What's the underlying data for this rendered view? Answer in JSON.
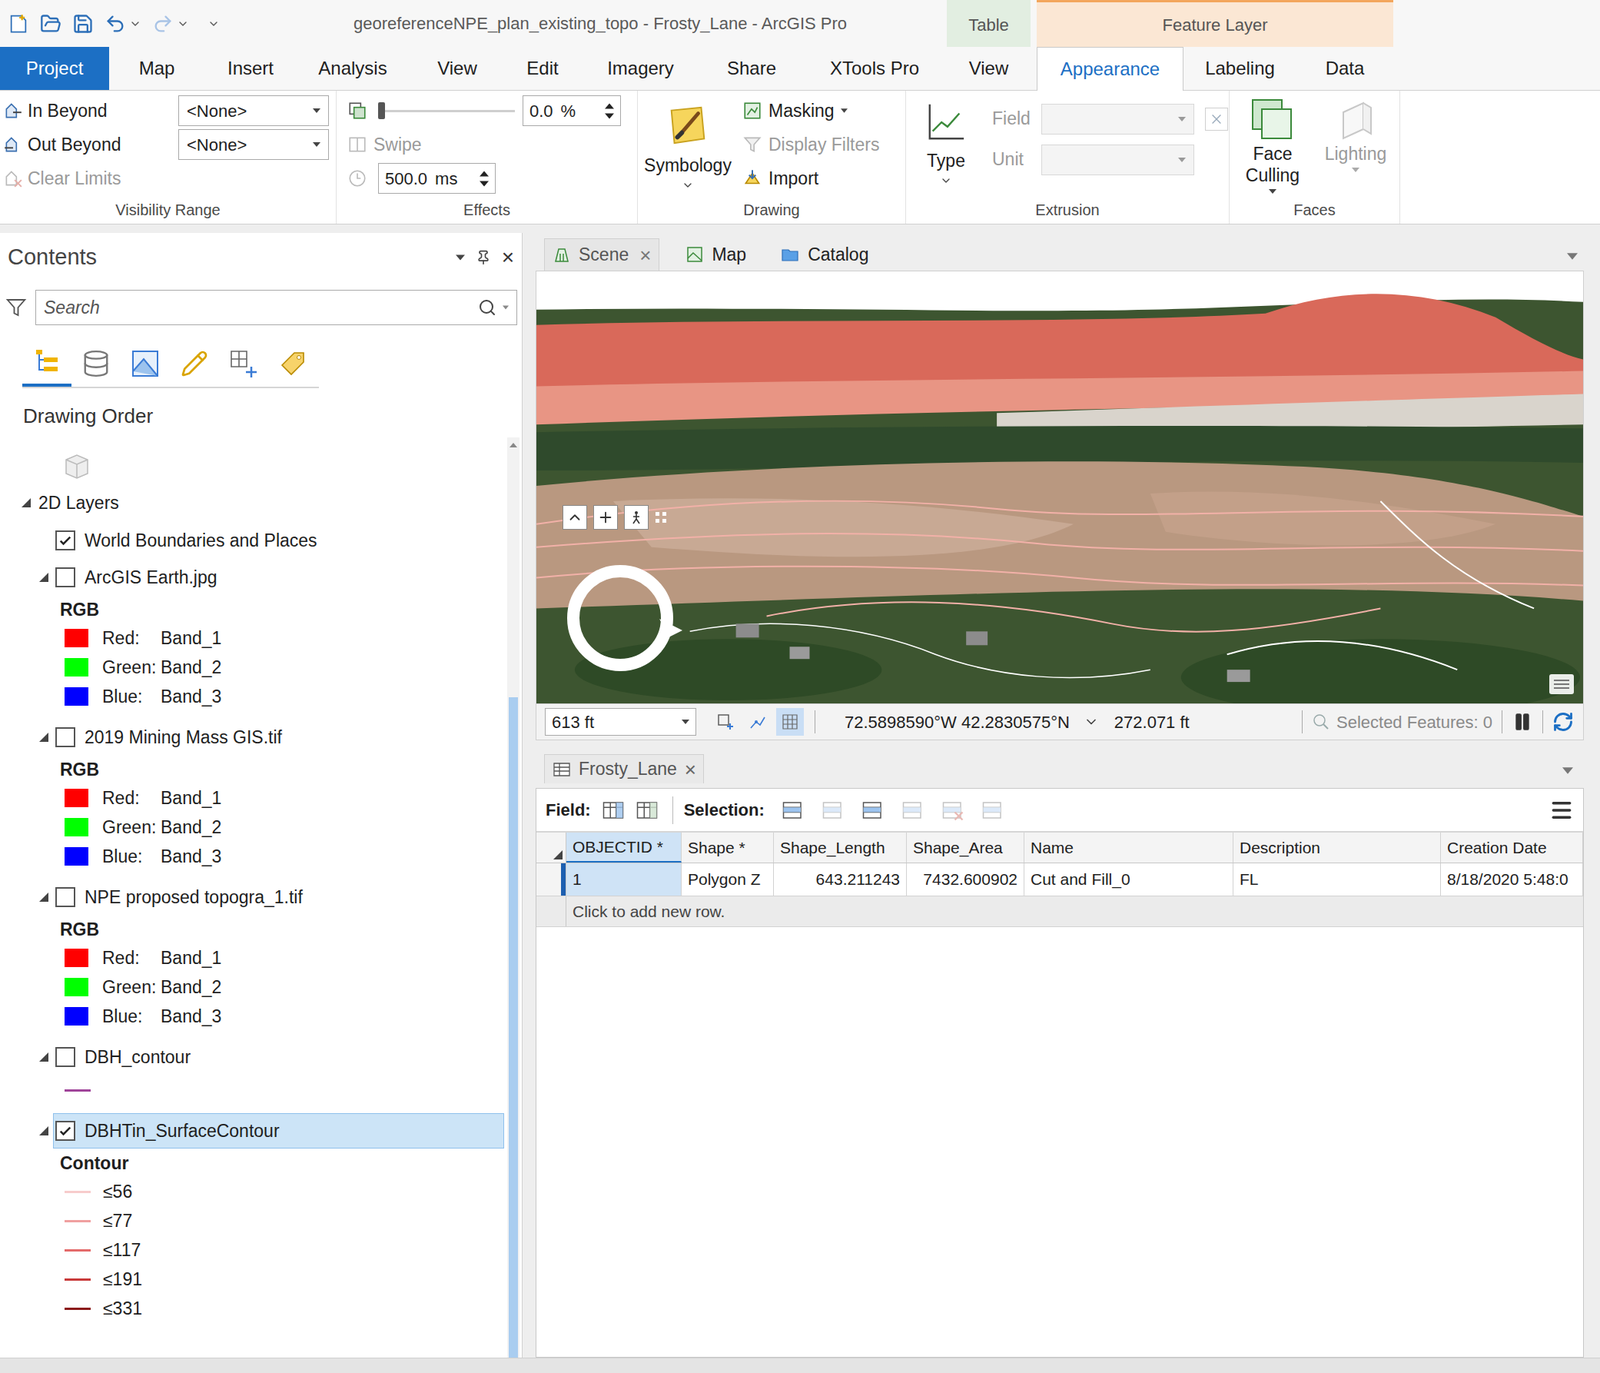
{
  "window": {
    "title": "georeferenceNPE_plan_existing_topo - Frosty_Lane - ArcGIS Pro"
  },
  "contextual_tabs": [
    {
      "label": "Table",
      "color": "#e2eee1",
      "accent": "#e2eee1"
    },
    {
      "label": "Feature Layer",
      "color": "#fbe7d4",
      "accent": "#f3a65c"
    }
  ],
  "ribbon_tabs": [
    {
      "label": "Project",
      "selected": false,
      "context": "none",
      "kind": "backstage"
    },
    {
      "label": "Map",
      "selected": false,
      "context": "none",
      "kind": "core"
    },
    {
      "label": "Insert",
      "selected": false,
      "context": "none",
      "kind": "core"
    },
    {
      "label": "Analysis",
      "selected": false,
      "context": "none",
      "kind": "core"
    },
    {
      "label": "View",
      "selected": false,
      "context": "none",
      "kind": "core"
    },
    {
      "label": "Edit",
      "selected": false,
      "context": "none",
      "kind": "core"
    },
    {
      "label": "Imagery",
      "selected": false,
      "context": "none",
      "kind": "core"
    },
    {
      "label": "Share",
      "selected": false,
      "context": "none",
      "kind": "core"
    },
    {
      "label": "XTools Pro",
      "selected": false,
      "context": "none",
      "kind": "core"
    },
    {
      "label": "View",
      "selected": false,
      "context": "Table",
      "kind": "core"
    },
    {
      "label": "Appearance",
      "selected": true,
      "context": "Feature Layer",
      "kind": "core"
    },
    {
      "label": "Labeling",
      "selected": false,
      "context": "Feature Layer",
      "kind": "core"
    },
    {
      "label": "Data",
      "selected": false,
      "context": "Feature Layer",
      "kind": "core"
    }
  ],
  "ribbon": {
    "visibility_range": {
      "label": "Visibility Range",
      "rows": [
        {
          "label": "In Beyond",
          "value": "<None>",
          "disabled": false
        },
        {
          "label": "Out Beyond",
          "value": "<None>",
          "disabled": false
        }
      ],
      "clear": {
        "label": "Clear Limits",
        "disabled": true
      }
    },
    "effects": {
      "label": "Effects",
      "transparency": {
        "level": 0,
        "value": "0.0",
        "unit": "%"
      },
      "swipe": {
        "label": "Swipe",
        "disabled": true
      },
      "flicker": {
        "value": "500.0",
        "unit": "ms",
        "icon_disabled": true
      }
    },
    "drawing": {
      "label": "Drawing",
      "symbology": {
        "label": "Symbology"
      },
      "items": [
        {
          "label": "Masking",
          "dropdown": true,
          "disabled": false,
          "kind": "masking"
        },
        {
          "label": "Display Filters",
          "dropdown": false,
          "disabled": true,
          "kind": "filters"
        },
        {
          "label": "Import",
          "dropdown": false,
          "disabled": false,
          "kind": "import"
        }
      ]
    },
    "extrusion": {
      "label": "Extrusion",
      "type": {
        "label": "Type"
      },
      "fields": [
        {
          "label": "Field",
          "disabled": true
        },
        {
          "label": "Unit",
          "disabled": true
        }
      ]
    },
    "faces": {
      "label": "Faces",
      "buttons": [
        {
          "lines": [
            "Face",
            "Culling"
          ],
          "disabled": false,
          "kind": "culling"
        },
        {
          "lines": [
            "Lighting"
          ],
          "disabled": true,
          "kind": "lighting"
        }
      ]
    }
  },
  "contents": {
    "title": "Contents",
    "close": "×",
    "search": {
      "placeholder": "Search"
    },
    "toolbar": [
      {
        "kind": "order",
        "selected": true
      },
      {
        "kind": "source",
        "selected": false
      },
      {
        "kind": "selection",
        "selected": false
      },
      {
        "kind": "editing",
        "selected": false
      },
      {
        "kind": "snapping",
        "selected": false
      },
      {
        "kind": "labeling",
        "selected": false
      }
    ],
    "section": "Drawing Order",
    "group": {
      "label": "2D Layers",
      "expanded": true
    },
    "layers": [
      {
        "name": "World Boundaries and Places",
        "checked": true,
        "expanded": false,
        "selected": false,
        "legend": null
      },
      {
        "name": "ArcGIS Earth.jpg",
        "checked": false,
        "expanded": true,
        "selected": false,
        "legend": {
          "kind": "rgb",
          "title": "RGB",
          "bands": [
            {
              "channel": "Red:",
              "band": "Band_1",
              "color": "#ff0000"
            },
            {
              "channel": "Green:",
              "band": "Band_2",
              "color": "#00ff00"
            },
            {
              "channel": "Blue:",
              "band": "Band_3",
              "color": "#0000ff"
            }
          ]
        }
      },
      {
        "name": "2019 Mining Mass GIS.tif",
        "checked": false,
        "expanded": true,
        "selected": false,
        "legend": {
          "kind": "rgb",
          "title": "RGB",
          "bands": [
            {
              "channel": "Red:",
              "band": "Band_1",
              "color": "#ff0000"
            },
            {
              "channel": "Green:",
              "band": "Band_2",
              "color": "#00ff00"
            },
            {
              "channel": "Blue:",
              "band": "Band_3",
              "color": "#0000ff"
            }
          ]
        }
      },
      {
        "name": "NPE proposed topogra_1.tif",
        "checked": false,
        "expanded": true,
        "selected": false,
        "legend": {
          "kind": "rgb",
          "title": "RGB",
          "bands": [
            {
              "channel": "Red:",
              "band": "Band_1",
              "color": "#ff0000"
            },
            {
              "channel": "Green:",
              "band": "Band_2",
              "color": "#00ff00"
            },
            {
              "channel": "Blue:",
              "band": "Band_3",
              "color": "#0000ff"
            }
          ]
        }
      },
      {
        "name": "DBH_contour",
        "checked": false,
        "expanded": true,
        "selected": false,
        "legend": {
          "kind": "line",
          "color": "#a0449a"
        }
      },
      {
        "name": "DBHTin_SurfaceContour",
        "checked": true,
        "expanded": true,
        "selected": true,
        "legend": {
          "kind": "contour",
          "title": "Contour",
          "classes": [
            {
              "label": "≤56",
              "color": "#f7cccc"
            },
            {
              "label": "≤77",
              "color": "#f0a0a0"
            },
            {
              "label": "≤117",
              "color": "#e46a6a"
            },
            {
              "label": "≤191",
              "color": "#c83a3a"
            },
            {
              "label": "≤331",
              "color": "#8b1a1a"
            }
          ]
        }
      }
    ],
    "scrollbar": {
      "thumb_start": 0.27,
      "thumb_size": 0.73
    }
  },
  "views": {
    "tabs": [
      {
        "label": "Scene",
        "selected": true,
        "closable": true,
        "kind": "scene"
      },
      {
        "label": "Map",
        "selected": false,
        "closable": false,
        "kind": "map"
      },
      {
        "label": "Catalog",
        "selected": false,
        "closable": false,
        "kind": "catalog"
      }
    ],
    "close": "×"
  },
  "scene_status": {
    "scale": "613 ft",
    "tools": [
      {
        "kind": "add",
        "selected": false
      },
      {
        "kind": "snap",
        "selected": false
      },
      {
        "kind": "grid",
        "selected": true
      }
    ],
    "coordinates": "72.5898590°W 42.2830575°N",
    "elevation": "272.071 ft",
    "selected_features": "Selected Features: 0",
    "paused": false
  },
  "table": {
    "tab": {
      "label": "Frosty_Lane",
      "close": "×"
    },
    "toolbar": {
      "field_label": "Field:",
      "selection_label": "Selection:",
      "field_tools": [
        {
          "disabled": false
        },
        {
          "disabled": false
        }
      ],
      "selection_tools": [
        {
          "disabled": false
        },
        {
          "disabled": true
        },
        {
          "disabled": false
        },
        {
          "disabled": true
        },
        {
          "disabled": true
        },
        {
          "disabled": true
        }
      ]
    },
    "columns": [
      {
        "label": "OBJECTID *",
        "selected": true
      },
      {
        "label": "Shape *",
        "selected": false
      },
      {
        "label": "Shape_Length",
        "selected": false
      },
      {
        "label": "Shape_Area",
        "selected": false
      },
      {
        "label": "Name",
        "selected": false
      },
      {
        "label": "Description",
        "selected": false
      },
      {
        "label": "Creation Date",
        "selected": false
      }
    ],
    "rows": [
      {
        "cells": [
          "1",
          "Polygon Z",
          "643.211243",
          "7432.600902",
          "Cut and Fill_0",
          "FL",
          "8/18/2020 5:48:0"
        ],
        "current": true
      }
    ],
    "add_row": "Click to add new row."
  }
}
